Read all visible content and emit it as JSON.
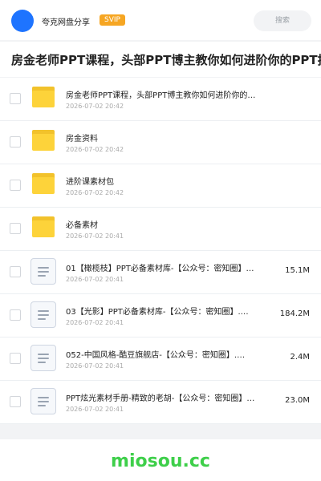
{
  "header": {
    "site_name": "夸克网盘分享",
    "badge": "SVIP",
    "search_placeholder": "搜索"
  },
  "folder_title": "房金老师PPT课程，头部PPT博主教你如何进阶你的PPT技能",
  "items": [
    {
      "type": "folder",
      "name": "房金老师PPT课程，头部PPT博主教你如何进阶你的…",
      "date": "2026-07-02 20:42",
      "size": ""
    },
    {
      "type": "folder",
      "name": "房金资料",
      "date": "2026-07-02 20:42",
      "size": ""
    },
    {
      "type": "folder",
      "name": "进阶课素材包",
      "date": "2026-07-02 20:42",
      "size": ""
    },
    {
      "type": "folder",
      "name": "必备素材",
      "date": "2026-07-02 20:41",
      "size": ""
    },
    {
      "type": "file",
      "name": "01【橄榄枝】PPT必备素材库-【公众号：密知圈】…",
      "date": "2026-07-02 20:41",
      "size": "15.1M"
    },
    {
      "type": "file",
      "name": "03【光影】PPT必备素材库-【公众号：密知圈】.…",
      "date": "2026-07-02 20:41",
      "size": "184.2M"
    },
    {
      "type": "file",
      "name": "052-中国风格-酷豆旗舰店-【公众号：密知圈】.…",
      "date": "2026-07-02 20:41",
      "size": "2.4M"
    },
    {
      "type": "file",
      "name": "PPT炫光素材手册-精致的老胡-【公众号：密知圈】…",
      "date": "2026-07-02 20:41",
      "size": "23.0M"
    }
  ],
  "watermark": "miosou.cc"
}
